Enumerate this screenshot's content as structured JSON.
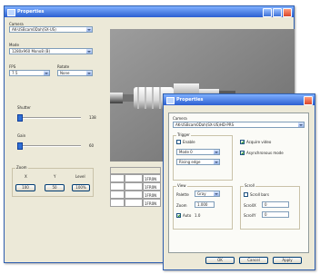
{
  "back_window": {
    "title": "Properties",
    "camera_label": "Camera",
    "camera_value": "AK-USBcam0Dah(SX-US)",
    "mode_label": "Mode",
    "mode_value": "1280x960 Mono8 (B)",
    "fps_label": "FPS",
    "fps_value": "7.5",
    "rotate_label": "Rotate",
    "rotate_value": "None",
    "shutter_label": "Shutter",
    "shutter_value": "138",
    "gain_label": "Gain",
    "gain_value": "60",
    "group_label": "Zoom",
    "zoom_cols": [
      "X",
      "Y",
      "Level"
    ],
    "zoom_values": [
      "100",
      "50",
      "100%"
    ],
    "table_rows": [
      [
        "",
        "",
        ""
      ],
      [
        "",
        "",
        "1FR0N"
      ],
      [
        "",
        "",
        "1FR0N"
      ],
      [
        "",
        "",
        "1FR0N"
      ],
      [
        "",
        "",
        "1FR0N"
      ]
    ]
  },
  "front_window": {
    "title": "Properties",
    "tabs": [
      "Source",
      "Format",
      "Exposure",
      "Gain",
      "Advanced"
    ],
    "active_tab": 0,
    "camera_label": "Camera",
    "camera_value": "AK-USBcam0Dah(SX-US)HD-PRS",
    "trigger_group": "Trigger",
    "trigger_enable": "Enable",
    "trigger_mode": "Mode 0",
    "trigger_source": "Rising edge",
    "acquire_video": "Acquire video",
    "async_mode": "Asynchronous mode",
    "view_group": "View",
    "palette_label": "Palette",
    "palette_value": "Gray",
    "zoom_label": "Zoom",
    "zoom_value": "1.000",
    "scroll_group": "Scroll",
    "scroll_fixed": "Scroll bars",
    "scroll_x_label": "ScrollX",
    "scroll_x_value": "0",
    "scroll_y_label": "ScrollY",
    "scroll_y_value": "0",
    "auto_label": "Auto",
    "auto_value": "1.0",
    "ok": "OK",
    "cancel": "Cancel",
    "apply": "Apply"
  }
}
